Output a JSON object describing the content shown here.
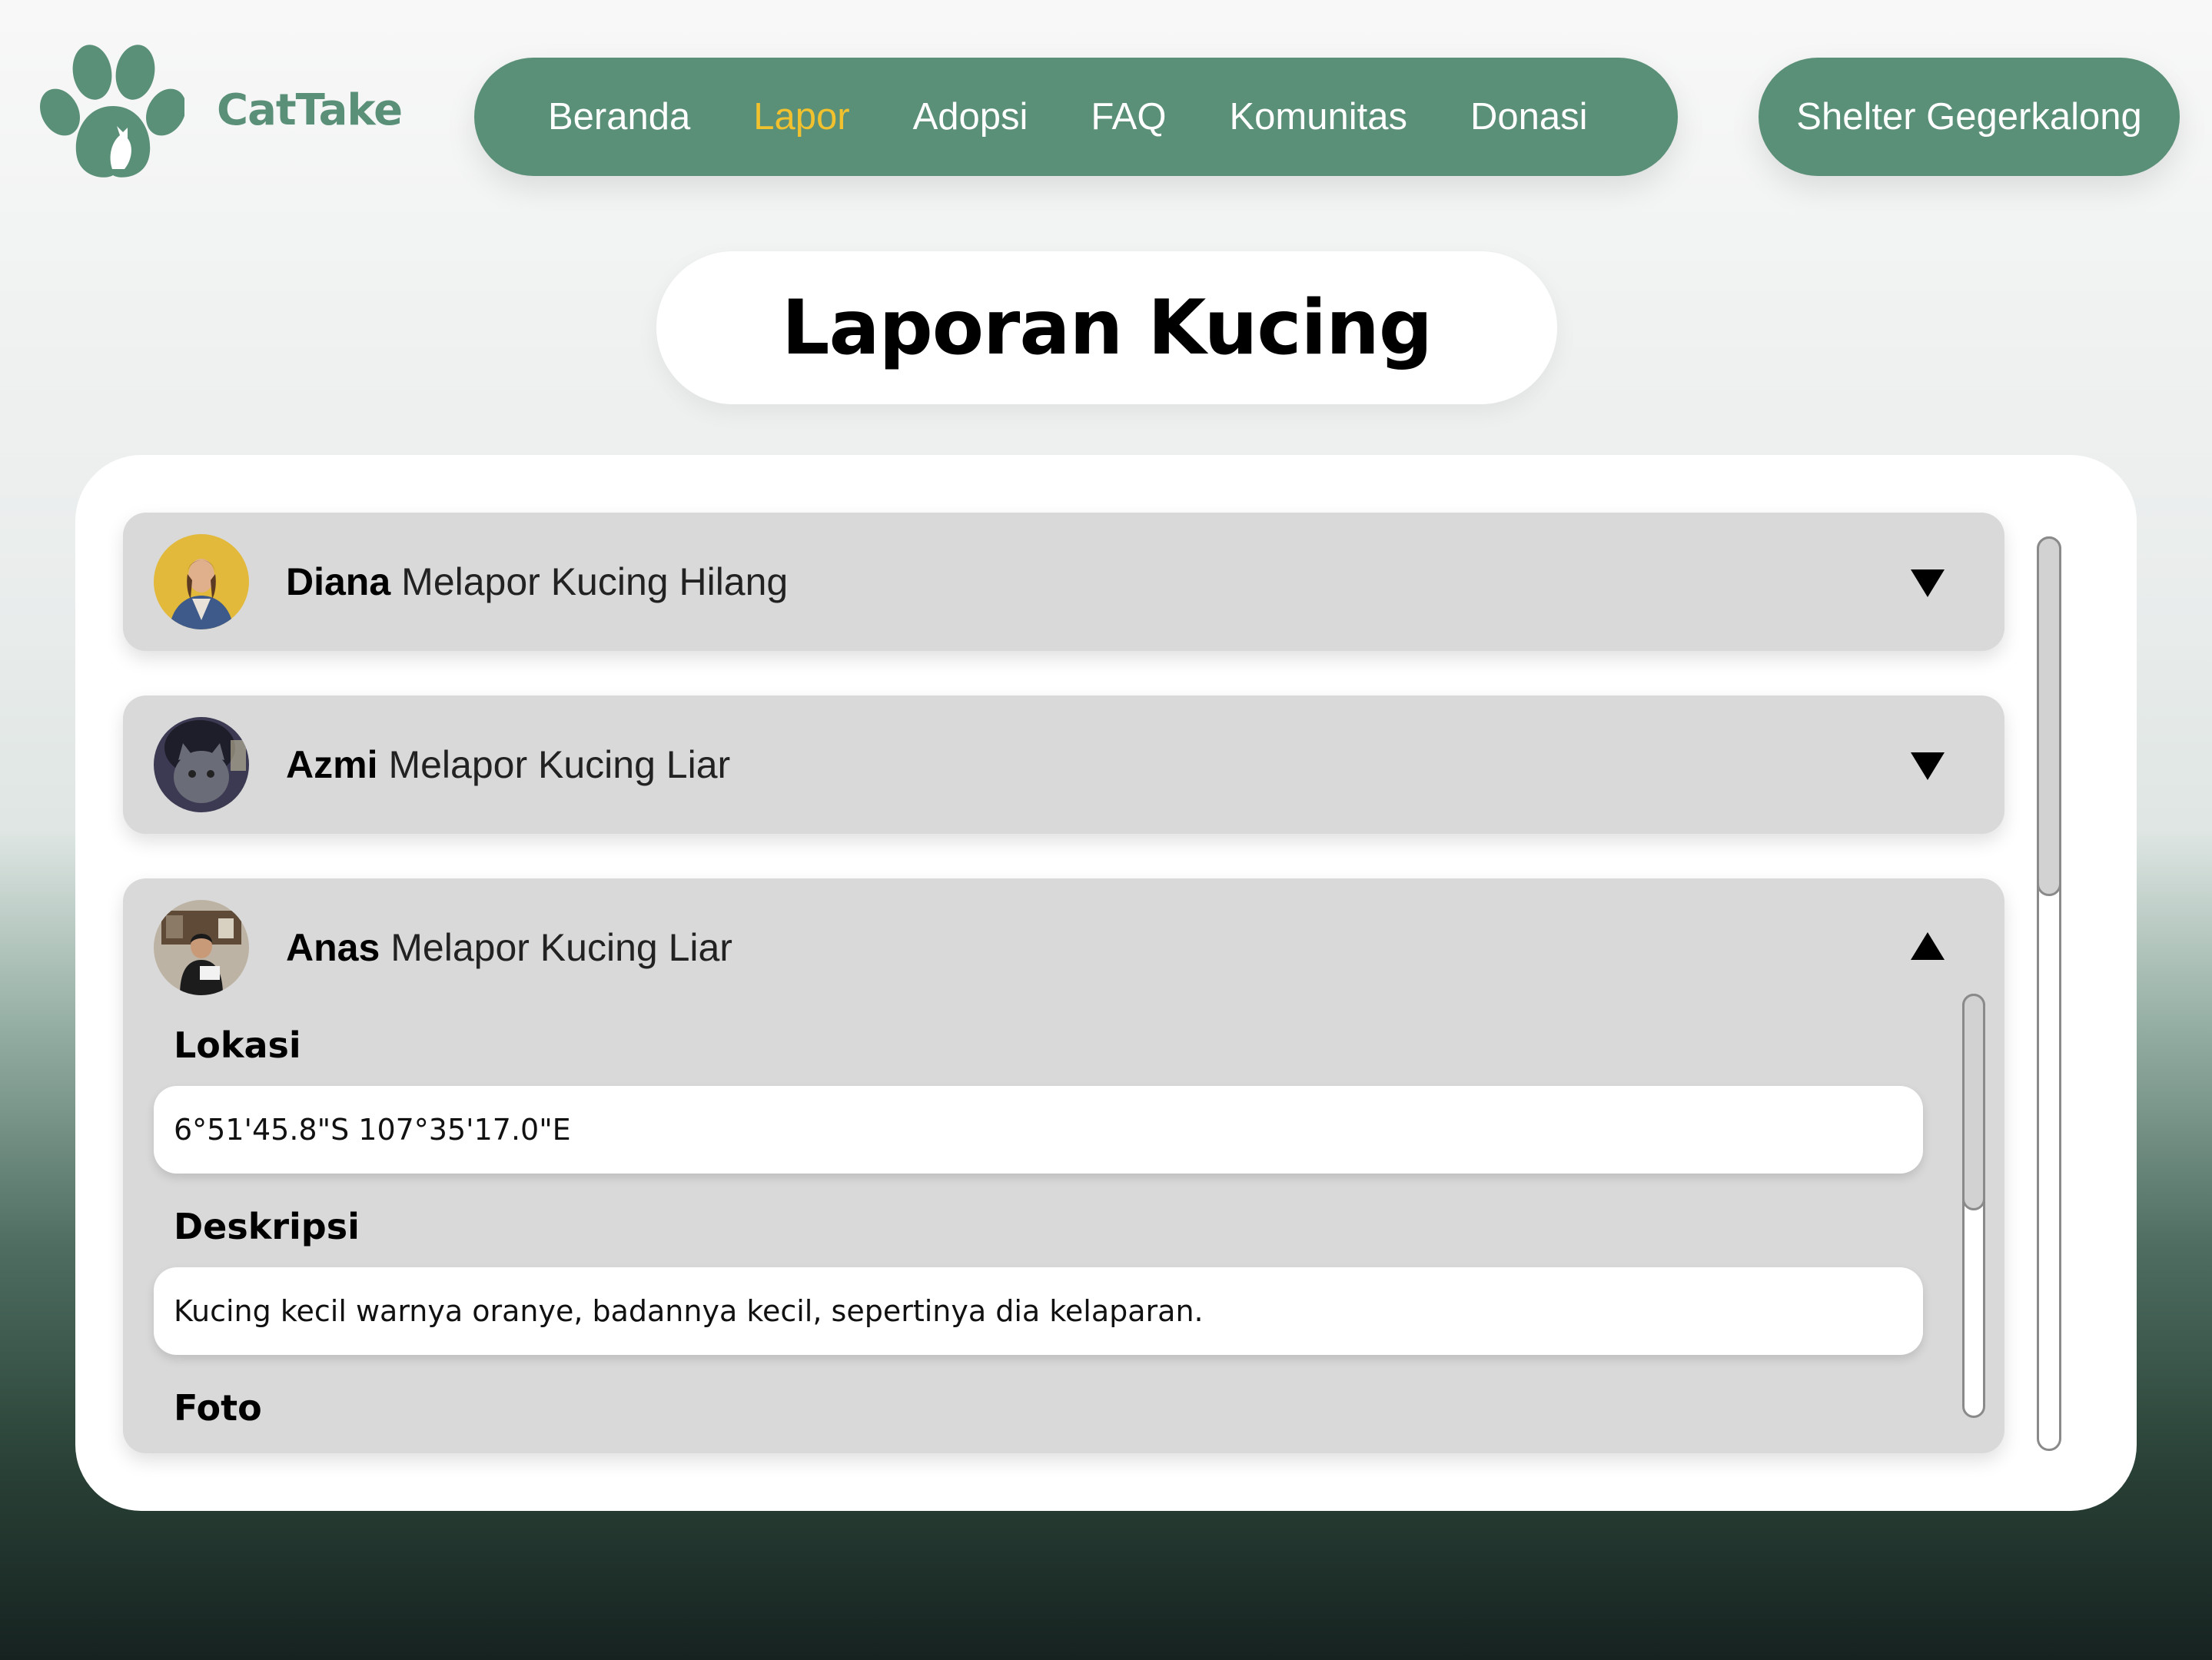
{
  "app": {
    "name": "CatTake"
  },
  "nav": {
    "items": [
      "Beranda",
      "Lapor",
      "Adopsi",
      "FAQ",
      "Komunitas",
      "Donasi"
    ],
    "active": "Lapor",
    "active_color": "#f2c12e"
  },
  "shelter_button": "Shelter Gegerkalong",
  "page_title": "Laporan Kucing",
  "colors": {
    "brand": "#5a8f78",
    "card": "#d9d9d9",
    "panel": "#ffffff"
  },
  "reports": [
    {
      "name": "Diana",
      "action": "Melapor Kucing Hilang",
      "expanded": false,
      "toggle_icon": "chevron-down-icon"
    },
    {
      "name": "Azmi",
      "action": "Melapor Kucing Liar",
      "expanded": false,
      "toggle_icon": "chevron-down-icon"
    },
    {
      "name": "Anas",
      "action": "Melapor Kucing Liar",
      "expanded": true,
      "toggle_icon": "chevron-up-icon",
      "details": {
        "lokasi_label": "Lokasi",
        "lokasi_value": "6°51'45.8\"S 107°35'17.0\"E",
        "deskripsi_label": "Deskripsi",
        "deskripsi_value": "Kucing kecil warnya oranye, badannya kecil, sepertinya dia kelaparan.",
        "foto_label": "Foto"
      }
    }
  ]
}
